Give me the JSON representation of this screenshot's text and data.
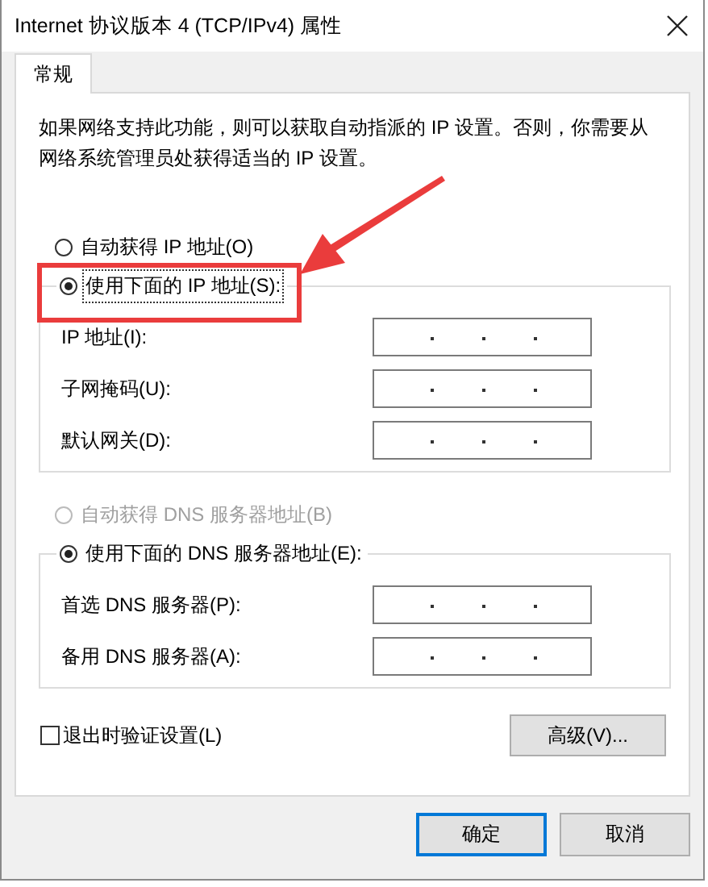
{
  "window": {
    "title": "Internet 协议版本 4 (TCP/IPv4) 属性"
  },
  "tabs": [
    {
      "label": "常规",
      "selected": true
    }
  ],
  "description": "如果网络支持此功能，则可以获取自动指派的 IP 设置。否则，你需要从网络系统管理员处获得适当的 IP 设置。",
  "ip_settings": {
    "options": [
      {
        "label": "自动获得 IP 地址(O)",
        "selected": false,
        "disabled": false,
        "focused": false
      },
      {
        "label": "使用下面的 IP 地址(S):",
        "selected": true,
        "disabled": false,
        "focused": true
      }
    ],
    "fields": [
      {
        "label": "IP 地址(I):"
      },
      {
        "label": "子网掩码(U):"
      },
      {
        "label": "默认网关(D):"
      }
    ]
  },
  "dns_settings": {
    "options": [
      {
        "label": "自动获得 DNS 服务器地址(B)",
        "selected": false,
        "disabled": true,
        "focused": false
      },
      {
        "label": "使用下面的 DNS 服务器地址(E):",
        "selected": true,
        "disabled": false,
        "focused": false
      }
    ],
    "fields": [
      {
        "label": "首选 DNS 服务器(P):"
      },
      {
        "label": "备用 DNS 服务器(A):"
      }
    ]
  },
  "validate_checkbox": {
    "label": "退出时验证设置(L)",
    "checked": false
  },
  "advanced_button": "高级(V)...",
  "buttons": [
    {
      "label": "确定",
      "default": true
    },
    {
      "label": "取消",
      "default": false
    }
  ]
}
